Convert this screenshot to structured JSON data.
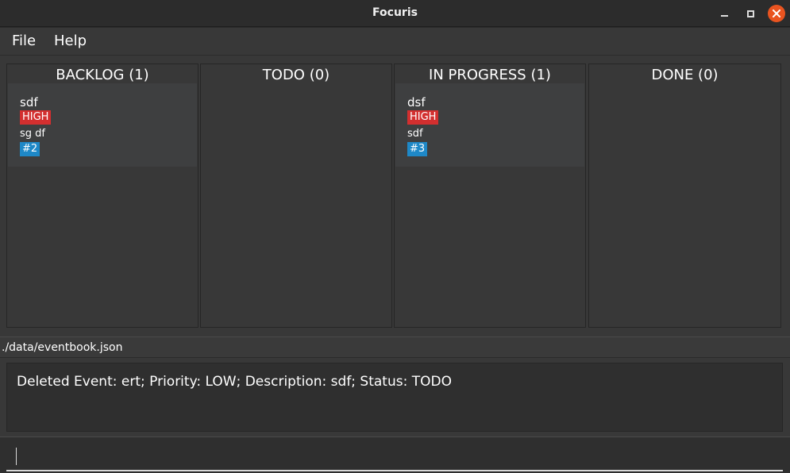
{
  "window": {
    "title": "Focuris",
    "close_color": "#e95420"
  },
  "menu": {
    "file": "File",
    "help": "Help"
  },
  "board": {
    "columns": [
      {
        "header": "BACKLOG (1)",
        "cards": [
          {
            "title": "sdf",
            "priority": "HIGH",
            "description": "sg df",
            "id": "#2"
          }
        ]
      },
      {
        "header": "TODO (0)",
        "cards": []
      },
      {
        "header": "IN PROGRESS (1)",
        "cards": [
          {
            "title": "dsf",
            "priority": "HIGH",
            "description": "sdf",
            "id": "#3"
          }
        ]
      },
      {
        "header": "DONE (0)",
        "cards": []
      }
    ]
  },
  "colors": {
    "priority_high": "#d32f2f",
    "id_badge": "#1e88c7"
  },
  "status": {
    "path": "./data/eventbook.json"
  },
  "result": {
    "message": "Deleted Event: ert; Priority: LOW; Description: sdf; Status: TODO"
  },
  "command": {
    "value": ""
  }
}
